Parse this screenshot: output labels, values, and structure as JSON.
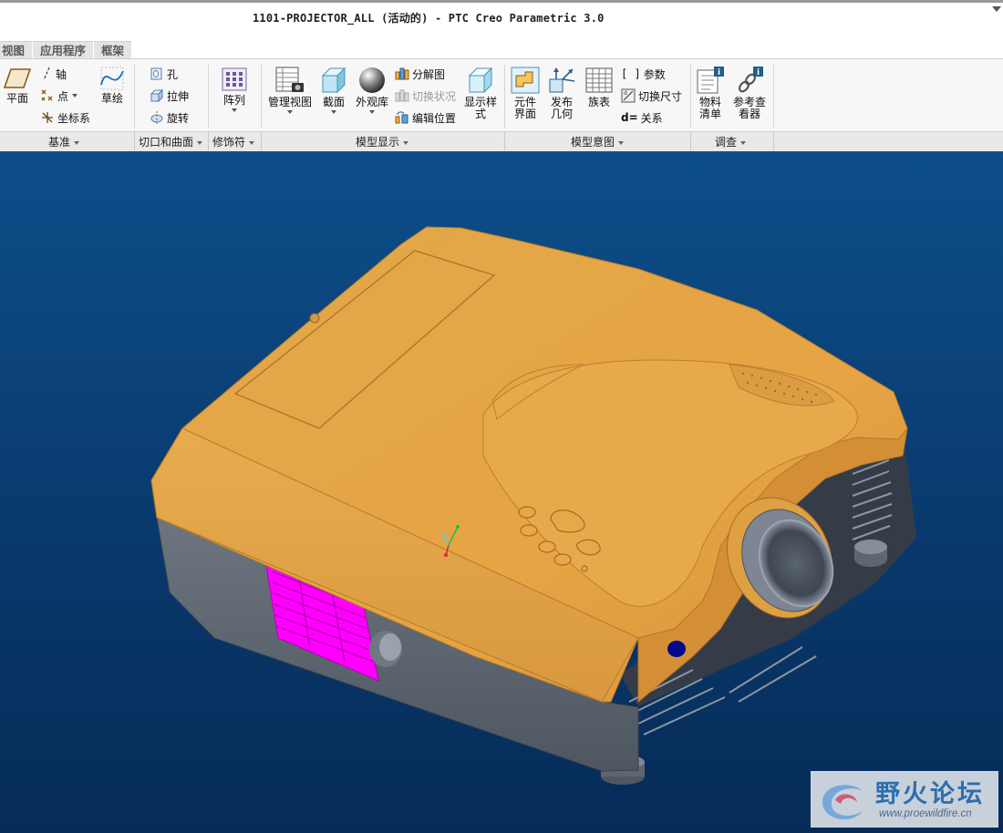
{
  "window": {
    "title": "1101-PROJECTOR_ALL (活动的) - PTC Creo Parametric 3.0"
  },
  "tabs": [
    "视图",
    "应用程序",
    "框架"
  ],
  "ribbon": {
    "groups": {
      "datum": "基准",
      "cut_surface": "切口和曲面",
      "modifier": "修饰符",
      "model_display": "模型显示",
      "model_intent": "模型意图",
      "investigate": "调查"
    },
    "datum": {
      "plane": "平面",
      "axis": "轴",
      "point": "点",
      "csys": "坐标系",
      "sketch": "草绘"
    },
    "cut_surface": {
      "hole": "孔",
      "extrude": "拉伸",
      "revolve": "旋转"
    },
    "modifier": {
      "pattern": "阵列"
    },
    "model_display": {
      "manage_views": "管理视图",
      "section": "截面",
      "appearance": "外观库",
      "explode_view": "分解图",
      "toggle_status": "切换状况",
      "edit_position": "编辑位置",
      "display_style_l1": "显示样",
      "display_style_l2": "式"
    },
    "model_intent": {
      "component_interface_l1": "元件",
      "component_interface_l2": "界面",
      "publish_geom_l1": "发布",
      "publish_geom_l2": "几何",
      "family_table": "族表",
      "parameters": "参数",
      "switch_dims": "切换尺寸",
      "relations": "关系"
    },
    "investigate": {
      "bom_l1": "物料",
      "bom_l2": "清单",
      "ref_viewer_l1": "参考查",
      "ref_viewer_l2": "看器"
    }
  },
  "colors": {
    "model_top": "#e3a342",
    "model_body": "#5b6470",
    "vent_highlight": "#ff00ff",
    "background_top": "#0d4f8a",
    "background_bottom": "#062b57"
  },
  "watermark": {
    "title": "野火论坛",
    "url": "www.proewildfire.cn"
  }
}
